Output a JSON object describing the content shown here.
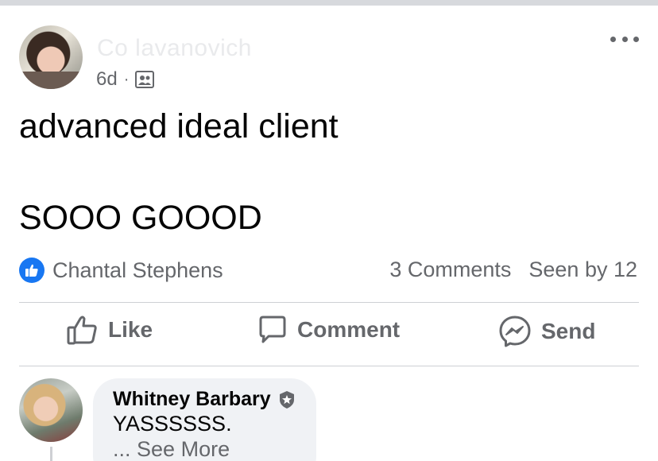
{
  "post": {
    "author_name": "Co                  lavanovich",
    "time": "6d",
    "separator": "·",
    "text_line1": "advanced ideal client",
    "text_line2": "SOOO GOOOD"
  },
  "reactions": {
    "reactor_name": "Chantal Stephens",
    "comments_count": "3 Comments",
    "seen_by": "Seen by 12"
  },
  "actions": {
    "like": "Like",
    "comment": "Comment",
    "send": "Send"
  },
  "comment": {
    "author": "Whitney Barbary",
    "text": "YASSSSSS.",
    "ellipsis": "...",
    "see_more": "See More"
  },
  "colors": {
    "accent": "#1877f2",
    "secondary_text": "#65676b",
    "bubble": "#f0f2f5",
    "divider": "#ced0d4"
  },
  "icons": {
    "privacy": "group-privacy-icon",
    "more": "more-options-icon",
    "like_badge": "like-reaction-icon",
    "like": "thumbs-up-icon",
    "comment": "comment-bubble-icon",
    "send": "messenger-icon",
    "badge": "admin-badge-icon"
  }
}
